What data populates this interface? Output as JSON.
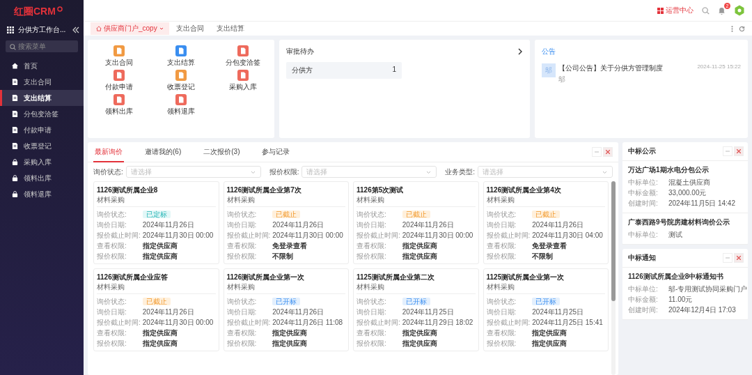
{
  "logo": "红圈CRM",
  "sidebar": {
    "workspace": "分供方工作台...",
    "search": {
      "placeholder": "搜索菜单"
    },
    "items": [
      {
        "label": "首页",
        "kind": "home",
        "selected": false
      },
      {
        "label": "支出合同",
        "kind": "page",
        "selected": false
      },
      {
        "label": "支出结算",
        "kind": "page",
        "selected": true
      },
      {
        "label": "分包变洽签",
        "kind": "page",
        "selected": false
      },
      {
        "label": "付款申请",
        "kind": "page",
        "selected": false
      },
      {
        "label": "收票登记",
        "kind": "page",
        "selected": false
      },
      {
        "label": "采购入库",
        "kind": "box",
        "selected": false
      },
      {
        "label": "领料出库",
        "kind": "box",
        "selected": false
      },
      {
        "label": "领料退库",
        "kind": "box",
        "selected": false
      }
    ]
  },
  "header": {
    "ops_center": "运营中心",
    "notification_count": "2"
  },
  "page_tabs": [
    {
      "label": "供应商门户_copy",
      "selected": true
    },
    {
      "label": "支出合同",
      "selected": false
    },
    {
      "label": "支出结算",
      "selected": false
    }
  ],
  "quick_links": [
    {
      "label": "支出合同",
      "color": "#f19a43"
    },
    {
      "label": "支出结算",
      "color": "#3a8ef0"
    },
    {
      "label": "分包变洽签",
      "color": "#ee6a5c"
    },
    {
      "label": "付款申请",
      "color": "#ee6a5c"
    },
    {
      "label": "收票登记",
      "color": "#f19a43"
    },
    {
      "label": "采购入库",
      "color": "#ee6a5c"
    },
    {
      "label": "领料出库",
      "color": "#ee6a5c"
    },
    {
      "label": "领料退库",
      "color": "#ee6a5c"
    }
  ],
  "approval": {
    "title": "审批待办",
    "items": [
      {
        "label": "分供方",
        "count": "1"
      }
    ]
  },
  "notice": {
    "title": "公告",
    "items": [
      {
        "thumb": "邬",
        "title": "【公司公告】关于分供方管理制度",
        "time": "2024-11-25 15:22",
        "author": "邬"
      }
    ]
  },
  "inquiry": {
    "tabs": [
      {
        "label": "最新询价",
        "selected": true
      },
      {
        "label": "邀请我的(6)",
        "selected": false
      },
      {
        "label": "二次报价(3)",
        "selected": false
      },
      {
        "label": "参与记录",
        "selected": false
      }
    ],
    "filters": [
      {
        "label": "询价状态:",
        "placeholder": "请选择"
      },
      {
        "label": "报价权限:",
        "placeholder": "请选择"
      },
      {
        "label": "业务类型:",
        "placeholder": "请选择"
      }
    ],
    "cards": [
      {
        "title": "1126测试所属企业8",
        "type": "材料采购",
        "fields": [
          {
            "label": "询价状态:",
            "value": "已定标",
            "kind": "awarded"
          },
          {
            "label": "询价日期:",
            "value": "2024年11月26日",
            "kind": "text"
          },
          {
            "label": "报价截止时间:",
            "value": "2024年11月30日 00:00",
            "kind": "text"
          },
          {
            "label": "查看权限:",
            "value": "指定供应商",
            "kind": "strong"
          },
          {
            "label": "报价权限:",
            "value": "指定供应商",
            "kind": "strong"
          }
        ]
      },
      {
        "title": "1126测试所属企业第7次",
        "type": "材料采购",
        "fields": [
          {
            "label": "询价状态:",
            "value": "已截止",
            "kind": "closed"
          },
          {
            "label": "询价日期:",
            "value": "2024年11月26日",
            "kind": "text"
          },
          {
            "label": "报价截止时间:",
            "value": "2024年11月30日 00:00",
            "kind": "text"
          },
          {
            "label": "查看权限:",
            "value": "免登录查看",
            "kind": "strong"
          },
          {
            "label": "报价权限:",
            "value": "不限制",
            "kind": "strong"
          }
        ]
      },
      {
        "title": "1126第5次测试",
        "type": "材料采购",
        "fields": [
          {
            "label": "询价状态:",
            "value": "已截止",
            "kind": "closed"
          },
          {
            "label": "询价日期:",
            "value": "2024年11月26日",
            "kind": "text"
          },
          {
            "label": "报价截止时间:",
            "value": "2024年11月30日 00:00",
            "kind": "text"
          },
          {
            "label": "查看权限:",
            "value": "指定供应商",
            "kind": "strong"
          },
          {
            "label": "报价权限:",
            "value": "指定供应商",
            "kind": "strong"
          }
        ]
      },
      {
        "title": "1126测试所属企业第4次",
        "type": "材料采购",
        "fields": [
          {
            "label": "询价状态:",
            "value": "已截止",
            "kind": "closed"
          },
          {
            "label": "询价日期:",
            "value": "2024年11月26日",
            "kind": "text"
          },
          {
            "label": "报价截止时间:",
            "value": "2024年11月30日 04:00",
            "kind": "text"
          },
          {
            "label": "查看权限:",
            "value": "免登录查看",
            "kind": "strong"
          },
          {
            "label": "报价权限:",
            "value": "不限制",
            "kind": "strong"
          }
        ]
      },
      {
        "title": "1126测试所属企业应答",
        "type": "材料采购",
        "fields": [
          {
            "label": "询价状态:",
            "value": "已截止",
            "kind": "closed"
          },
          {
            "label": "询价日期:",
            "value": "2024年11月26日",
            "kind": "text"
          },
          {
            "label": "报价截止时间:",
            "value": "2024年11月30日 00:00",
            "kind": "text"
          },
          {
            "label": "查看权限:",
            "value": "指定供应商",
            "kind": "strong"
          },
          {
            "label": "报价权限:",
            "value": "指定供应商",
            "kind": "strong"
          }
        ]
      },
      {
        "title": "1126测试所属企业第一次",
        "type": "材料采购",
        "fields": [
          {
            "label": "询价状态:",
            "value": "已开标",
            "kind": "opened"
          },
          {
            "label": "询价日期:",
            "value": "2024年11月26日",
            "kind": "text"
          },
          {
            "label": "报价截止时间:",
            "value": "2024年11月26日 11:08",
            "kind": "text"
          },
          {
            "label": "查看权限:",
            "value": "指定供应商",
            "kind": "strong"
          },
          {
            "label": "报价权限:",
            "value": "指定供应商",
            "kind": "strong"
          }
        ]
      },
      {
        "title": "1125测试所属企业第二次",
        "type": "材料采购",
        "fields": [
          {
            "label": "询价状态:",
            "value": "已开标",
            "kind": "opened"
          },
          {
            "label": "询价日期:",
            "value": "2024年11月25日",
            "kind": "text"
          },
          {
            "label": "报价截止时间:",
            "value": "2024年11月29日 18:02",
            "kind": "text"
          },
          {
            "label": "查看权限:",
            "value": "指定供应商",
            "kind": "strong"
          },
          {
            "label": "报价权限:",
            "value": "指定供应商",
            "kind": "strong"
          }
        ]
      },
      {
        "title": "1125测试所属企业第一次",
        "type": "材料采购",
        "fields": [
          {
            "label": "询价状态:",
            "value": "已开标",
            "kind": "opened"
          },
          {
            "label": "询价日期:",
            "value": "2024年11月25日",
            "kind": "text"
          },
          {
            "label": "报价截止时间:",
            "value": "2024年11月25日 15:41",
            "kind": "text"
          },
          {
            "label": "查看权限:",
            "value": "指定供应商",
            "kind": "strong"
          },
          {
            "label": "报价权限:",
            "value": "指定供应商",
            "kind": "strong"
          }
        ]
      }
    ]
  },
  "award_public": {
    "title": "中标公示",
    "items": [
      {
        "title": "万达广场1期水电分包公示",
        "fields": [
          {
            "label": "中标单位:",
            "value": "混凝土供应商"
          },
          {
            "label": "中标金额:",
            "value": "33,000.00元"
          },
          {
            "label": "创建时间:",
            "value": "2024年11月5日 14:42"
          }
        ]
      },
      {
        "title": "广泰西路9号院房建材料询价公示",
        "fields": [
          {
            "label": "中标单位:",
            "value": "测试"
          }
        ]
      }
    ]
  },
  "award_notice": {
    "title": "中标通知",
    "items": [
      {
        "title": "1126测试所属企业8中标通知书",
        "fields": [
          {
            "label": "中标单位:",
            "value": "邬-专用测试协同采购门户"
          },
          {
            "label": "中标金额:",
            "value": "11.00元"
          },
          {
            "label": "创建时间:",
            "value": "2024年12月4日 17:03"
          }
        ]
      }
    ]
  }
}
